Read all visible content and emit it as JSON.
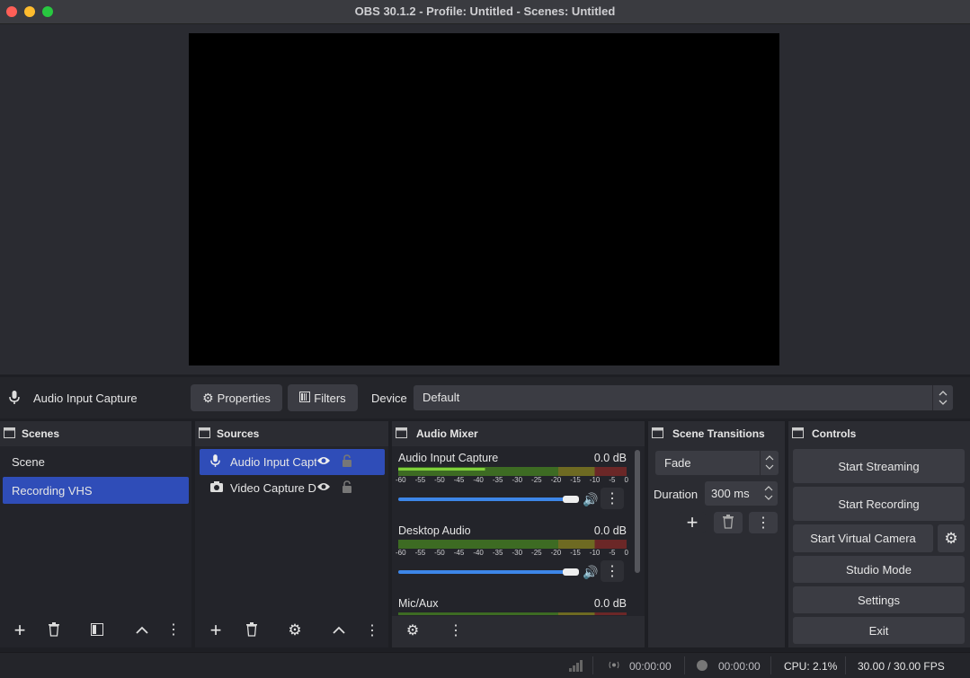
{
  "window": {
    "title": "OBS 30.1.2 - Profile: Untitled - Scenes: Untitled"
  },
  "props_bar": {
    "source_name": "Audio Input Capture",
    "properties_label": "Properties",
    "filters_label": "Filters",
    "device_label": "Device",
    "device_value": "Default"
  },
  "docks": {
    "scenes": {
      "title": "Scenes",
      "items": [
        "Scene",
        "Recording VHS"
      ],
      "selected": 1
    },
    "sources": {
      "title": "Sources",
      "items": [
        "Audio Input Capt",
        "Video Capture De"
      ],
      "selected": 0
    },
    "mixer": {
      "title": "Audio Mixer",
      "channels": [
        {
          "name": "Audio Input Capture",
          "db": "0.0 dB",
          "volume": 1.0
        },
        {
          "name": "Desktop Audio",
          "db": "0.0 dB",
          "volume": 1.0
        },
        {
          "name": "Mic/Aux",
          "db": "0.0 dB",
          "volume": 1.0
        }
      ],
      "ticks": [
        "-60",
        "-55",
        "-50",
        "-45",
        "-40",
        "-35",
        "-30",
        "-25",
        "-20",
        "-15",
        "-10",
        "-5",
        "0"
      ]
    },
    "transitions": {
      "title": "Scene Transitions",
      "transition": "Fade",
      "duration_label": "Duration",
      "duration_value": "300 ms"
    },
    "controls": {
      "title": "Controls",
      "start_streaming": "Start Streaming",
      "start_recording": "Start Recording",
      "start_virtual_camera": "Start Virtual Camera",
      "studio_mode": "Studio Mode",
      "settings": "Settings",
      "exit": "Exit"
    }
  },
  "status": {
    "stream_time": "00:00:00",
    "record_time": "00:00:00",
    "cpu": "CPU: 2.1%",
    "fps": "30.00 / 30.00 FPS"
  },
  "colors": {
    "accent": "#2f4db8",
    "slider": "#3d86e8",
    "close": "#ff5f57",
    "minimize": "#febc2e",
    "maximize": "#28c840"
  }
}
